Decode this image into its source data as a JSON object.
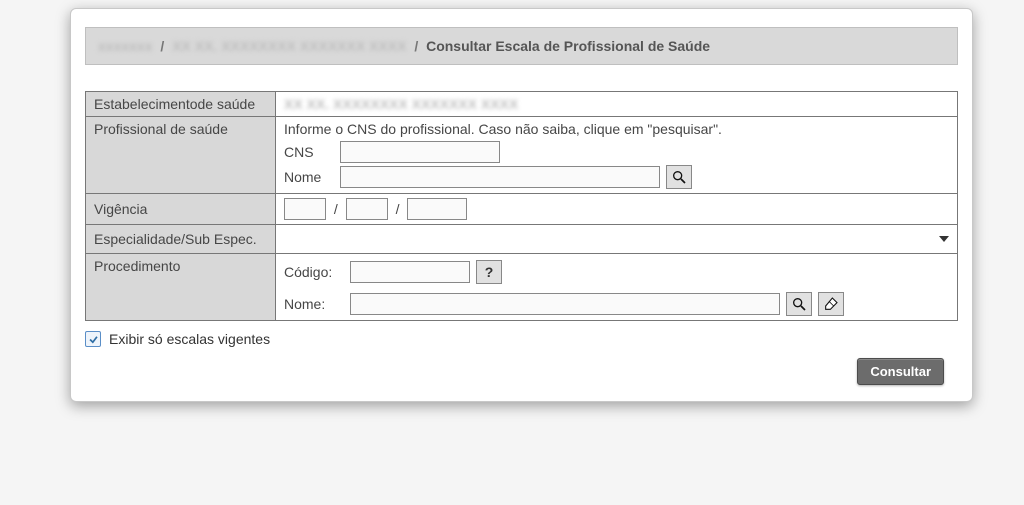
{
  "breadcrumb": {
    "item1": "xxxxxxx",
    "item2": "XX XX. XXXXXXXX XXXXXXX XXXX",
    "current": "Consultar Escala de Profissional de Saúde"
  },
  "labels": {
    "estabelecimento": "Estabelecimentode saúde",
    "profissional": "Profissional de saúde",
    "vigencia": "Vigência",
    "especialidade": "Especialidade/Sub Espec.",
    "procedimento": "Procedimento"
  },
  "values": {
    "estabelecimento": "XX XX.  XXXXXXXX  XXXXXXX  XXXX"
  },
  "profissional": {
    "hint": "Informe o CNS do profissional. Caso não saiba, clique em \"pesquisar\".",
    "cns_label": "CNS",
    "nome_label": "Nome",
    "cns_value": "",
    "nome_value": ""
  },
  "vigencia": {
    "d": "",
    "m": "",
    "y": ""
  },
  "especialidade": {
    "selected": ""
  },
  "procedimento": {
    "codigo_label": "Código:",
    "nome_label": "Nome:",
    "codigo_value": "",
    "nome_value": ""
  },
  "checkbox": {
    "label": "Exibir só escalas vigentes",
    "checked": true
  },
  "buttons": {
    "consultar": "Consultar",
    "help": "?"
  }
}
